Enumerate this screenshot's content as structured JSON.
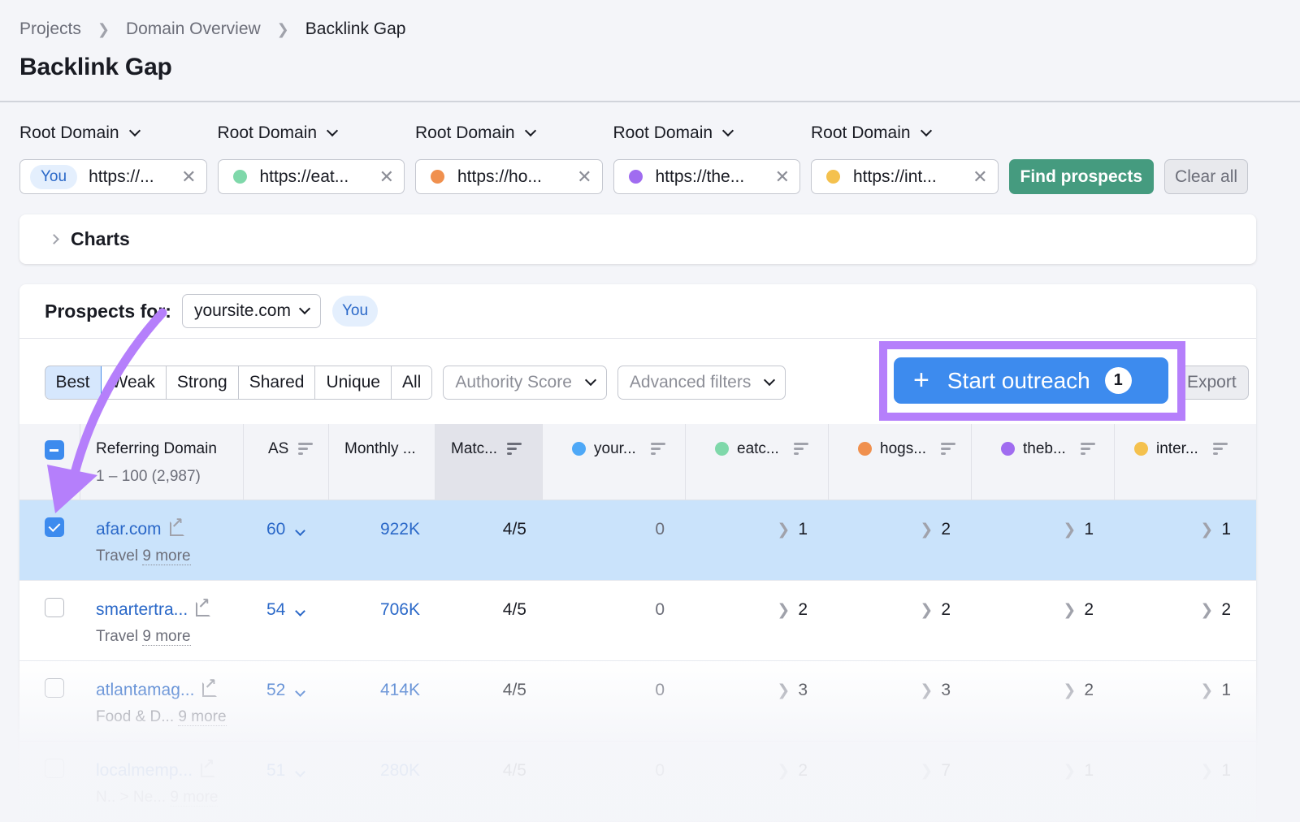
{
  "breadcrumb": [
    "Projects",
    "Domain Overview",
    "Backlink Gap"
  ],
  "page_title": "Backlink Gap",
  "domain_type_label": "Root Domain",
  "domains": [
    {
      "badge": "You",
      "value": "https://...",
      "color": null
    },
    {
      "badge": null,
      "value": "https://eat...",
      "color": "#7fd8aa"
    },
    {
      "badge": null,
      "value": "https://ho...",
      "color": "#f0904e"
    },
    {
      "badge": null,
      "value": "https://the...",
      "color": "#a06cf0"
    },
    {
      "badge": null,
      "value": "https://int...",
      "color": "#f4c14e"
    }
  ],
  "actions": {
    "find_prospects": "Find prospects",
    "clear_all": "Clear all"
  },
  "charts_panel": {
    "title": "Charts"
  },
  "prospects": {
    "label": "Prospects for:",
    "selected_site": "yoursite.com",
    "you_badge": "You"
  },
  "tabs": [
    "Best",
    "Weak",
    "Strong",
    "Shared",
    "Unique",
    "All"
  ],
  "active_tab": "Best",
  "filters": {
    "authority_score": "Authority Score",
    "advanced": "Advanced filters"
  },
  "outreach": {
    "label": "Start outreach",
    "count": "1",
    "plus": "+"
  },
  "export_label": "Export",
  "table": {
    "columns": {
      "referring_domain": "Referring Domain",
      "range": "1 – 100 (2,987)",
      "as": "AS",
      "monthly": "Monthly ...",
      "match": "Matc...",
      "competitors": [
        {
          "label": "your...",
          "color": "#4ea8f7"
        },
        {
          "label": "eatc...",
          "color": "#7fd8aa"
        },
        {
          "label": "hogs...",
          "color": "#f0904e"
        },
        {
          "label": "theb...",
          "color": "#a06cf0"
        },
        {
          "label": "inter...",
          "color": "#f4c14e"
        }
      ]
    },
    "rows": [
      {
        "domain": "afar.com",
        "category": "Travel",
        "more": "9 more",
        "as": "60",
        "monthly": "922K",
        "match": "4/5",
        "values": [
          "0",
          "1",
          "2",
          "1",
          "1"
        ],
        "selected": true
      },
      {
        "domain": "smartertra...",
        "category": "Travel",
        "more": "9 more",
        "as": "54",
        "monthly": "706K",
        "match": "4/5",
        "values": [
          "0",
          "2",
          "2",
          "2",
          "2"
        ],
        "selected": false
      },
      {
        "domain": "atlantamag...",
        "category": "Food & D...",
        "more": "9 more",
        "as": "52",
        "monthly": "414K",
        "match": "4/5",
        "values": [
          "0",
          "3",
          "3",
          "2",
          "1"
        ],
        "selected": false
      },
      {
        "domain": "localmemp...",
        "category": "N.. > Ne...",
        "more": "9 more",
        "as": "51",
        "monthly": "280K",
        "match": "4/5",
        "values": [
          "0",
          "2",
          "7",
          "1",
          "1"
        ],
        "selected": false
      }
    ]
  },
  "annotation_color": "#b57ffb"
}
